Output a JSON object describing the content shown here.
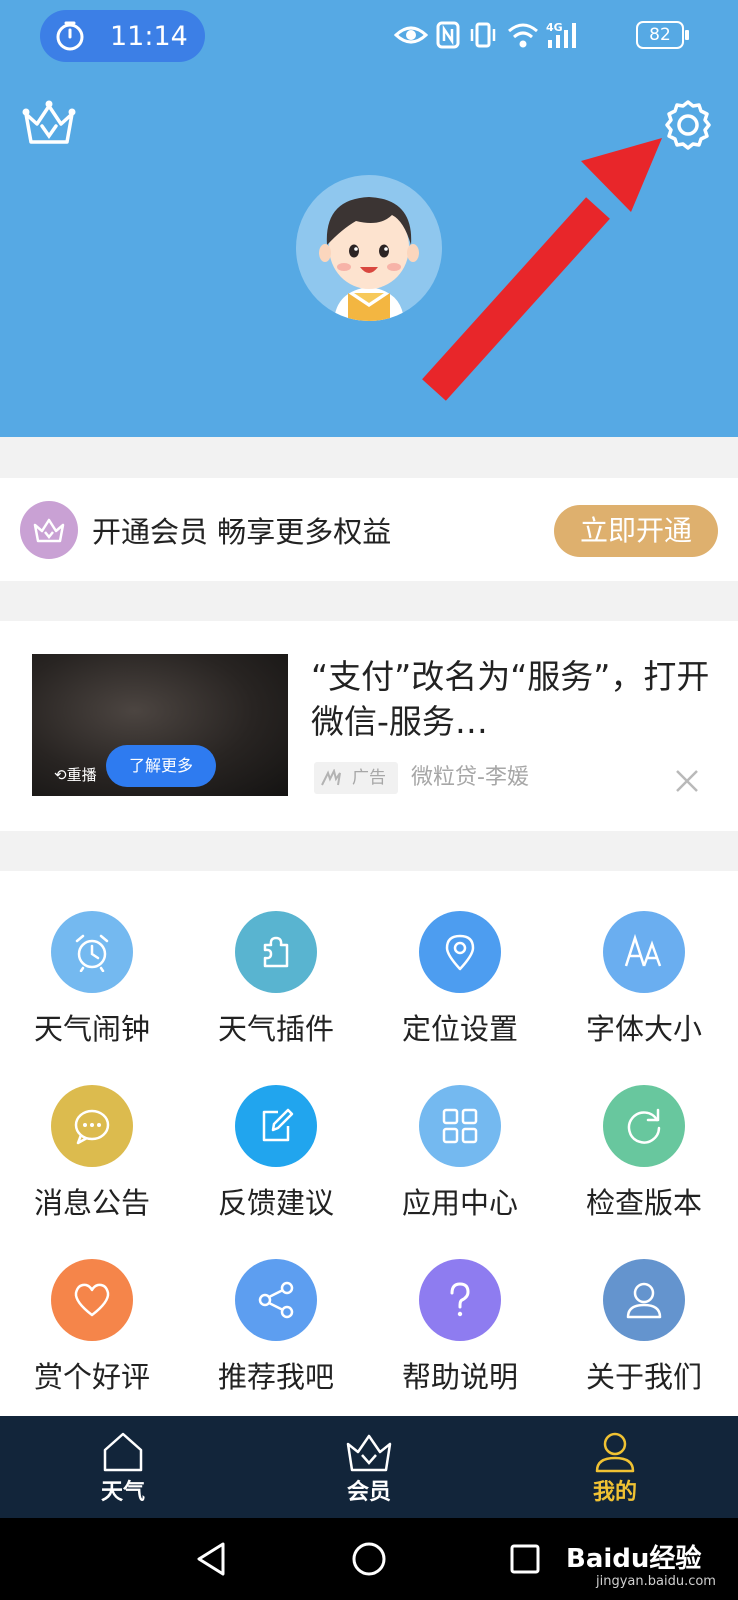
{
  "status_bar": {
    "time": "11:14",
    "battery": "82",
    "network": "4G"
  },
  "member_promo": {
    "text": "开通会员 畅享更多权益",
    "button": "立即开通"
  },
  "ad": {
    "title": "“支付”改名为“服务”，打开微信-服务…",
    "replay": "重播",
    "learn_more": "了解更多",
    "tag": "广告",
    "source": "微粒贷-李媛"
  },
  "features": [
    {
      "label": "天气闹钟",
      "icon": "alarm-clock-icon",
      "color": "#74b9f0"
    },
    {
      "label": "天气插件",
      "icon": "puzzle-icon",
      "color": "#59b4d0"
    },
    {
      "label": "定位设置",
      "icon": "location-pin-icon",
      "color": "#4d9df0"
    },
    {
      "label": "字体大小",
      "icon": "font-size-icon",
      "color": "#6aaef0"
    },
    {
      "label": "消息公告",
      "icon": "message-icon",
      "color": "#dcbb4e"
    },
    {
      "label": "反馈建议",
      "icon": "edit-icon",
      "color": "#21a5ee"
    },
    {
      "label": "应用中心",
      "icon": "apps-grid-icon",
      "color": "#74b9f0"
    },
    {
      "label": "检查版本",
      "icon": "refresh-icon",
      "color": "#68c79e"
    },
    {
      "label": "赏个好评",
      "icon": "heart-icon",
      "color": "#f5854a"
    },
    {
      "label": "推荐我吧",
      "icon": "share-icon",
      "color": "#5d9ef0"
    },
    {
      "label": "帮助说明",
      "icon": "help-icon",
      "color": "#8e7cf0"
    },
    {
      "label": "关于我们",
      "icon": "user-icon",
      "color": "#6494ce"
    }
  ],
  "tabs": [
    {
      "label": "天气",
      "icon": "home-icon",
      "active": false
    },
    {
      "label": "会员",
      "icon": "crown-icon",
      "active": false
    },
    {
      "label": "我的",
      "icon": "user-icon",
      "active": true
    }
  ],
  "watermark": {
    "text": "Baidu经验",
    "url": "jingyan.baidu.com"
  },
  "colors": {
    "header": "#56a9e4",
    "member_button": "#deb06e",
    "tab_bar": "#12253a",
    "active_tab": "#f0c233",
    "arrow": "#e8262a"
  }
}
